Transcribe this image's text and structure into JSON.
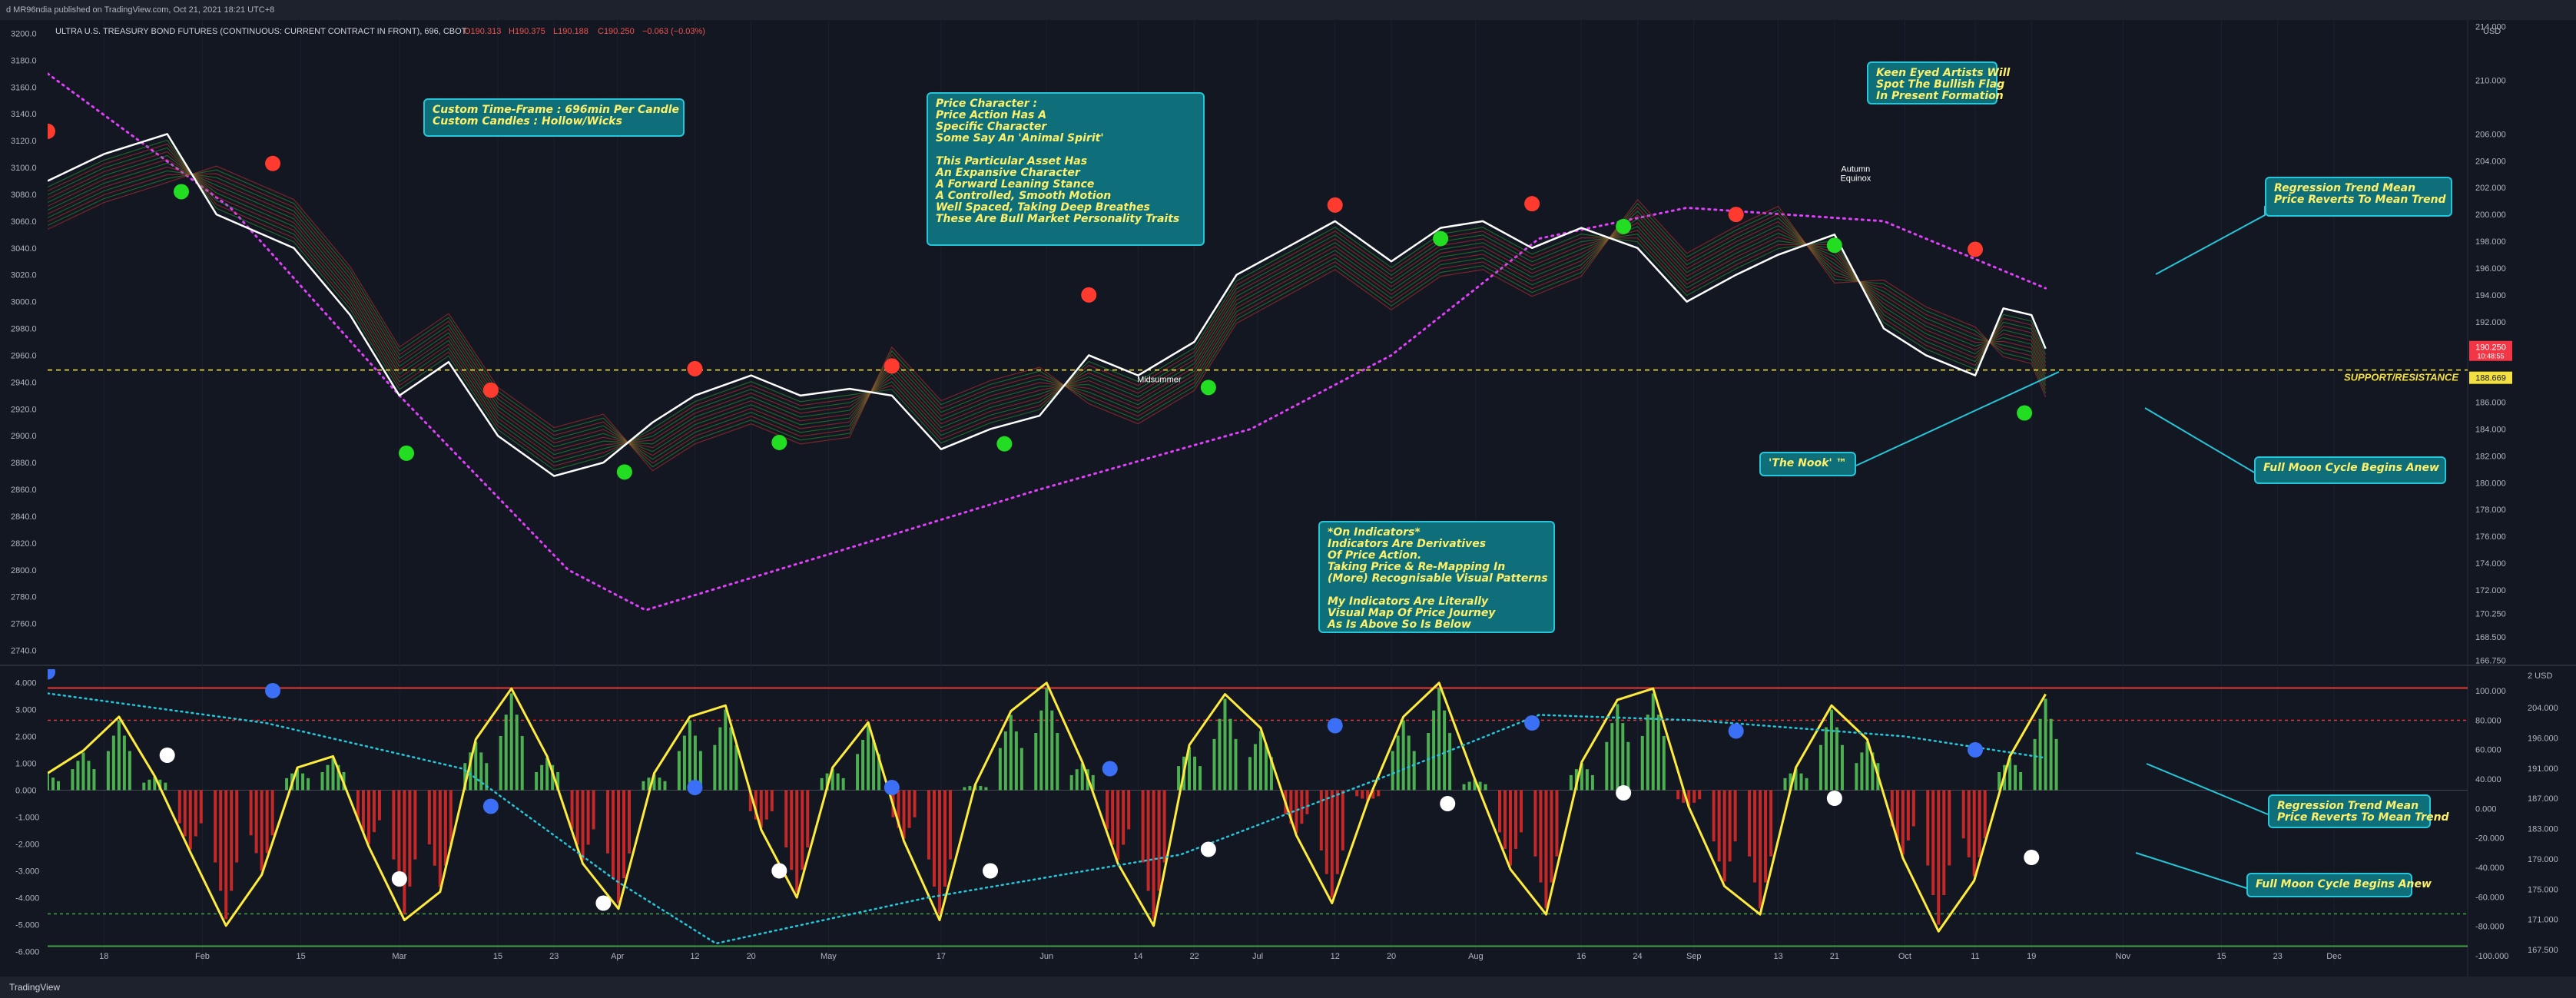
{
  "header": {
    "publisher": "d MR96ndia published on TradingView.com, Oct 21, 2021 18:21 UTC+8",
    "symbol_line": "ULTRA U.S. TREASURY BOND FUTURES (CONTINUOUS: CURRENT CONTRACT IN FRONT), 696, CBOT",
    "ohlc": {
      "o": "O190.313",
      "h": "H190.375",
      "l": "L190.188",
      "c": "C190.250",
      "chg": "−0.063 (−0.03%)"
    }
  },
  "footer": {
    "brand": "TradingView"
  },
  "colors": {
    "background": "#131722",
    "price_line": "#ffffff",
    "bear_ribbon": "#d32f2f",
    "bull_ribbon": "#2e9e2e",
    "support_line": "#f5e042",
    "oscillator_line": "#ffeb3b",
    "up_hist": "#4caf50",
    "down_hist": "#c62828",
    "note_bg": "#0e6e7a",
    "note_border": "#26c6da",
    "note_text": "#fff06a",
    "mean_curve": "#e040fb",
    "osc_mean_curve": "#26c6da",
    "red_dot": "#ff3b30",
    "green_dot": "#22dd22",
    "blue_dot": "#3b6ff5",
    "white_dot": "#ffffff",
    "price_tag": "#f23645",
    "support_tag": "#f5e042"
  },
  "chart_data": [
    {
      "type": "line",
      "panel": "price",
      "series": [
        {
          "x": [
            "Jan 10",
            "Jan 18",
            "Jan 27",
            "Feb 3",
            "Feb 14",
            "Feb 22",
            "Mar 1",
            "Mar 8",
            "Mar 15",
            "Mar 23",
            "Mar 30",
            "Apr 6",
            "Apr 12",
            "Apr 20",
            "Apr 27",
            "May 4",
            "May 10",
            "May 17",
            "May 24",
            "May 31",
            "Jun 7",
            "Jun 14",
            "Jun 22",
            "Jun 28",
            "Jul 5",
            "Jul 12",
            "Jul 20",
            "Jul 27",
            "Aug 2",
            "Aug 9",
            "Aug 16",
            "Aug 24",
            "Aug 31",
            "Sep 7",
            "Sep 13",
            "Sep 21",
            "Sep 28",
            "Oct 4",
            "Oct 11",
            "Oct 15",
            "Oct 19",
            "Oct 21"
          ],
          "values": [
            3090,
            3110,
            3125,
            3065,
            3040,
            2990,
            2930,
            2955,
            2900,
            2870,
            2880,
            2910,
            2930,
            2945,
            2930,
            2935,
            2930,
            2890,
            2905,
            2915,
            2960,
            2945,
            2970,
            3020,
            3040,
            3060,
            3030,
            3055,
            3060,
            3040,
            3055,
            3040,
            3000,
            3020,
            3035,
            3050,
            2980,
            2960,
            2945,
            2995,
            2990,
            2965
          ]
        }
      ],
      "yaxis_left": [
        "3200.0",
        "3180.0",
        "3160.0",
        "3140.0",
        "3120.0",
        "3100.0",
        "3080.0",
        "3060.0",
        "3040.0",
        "3020.0",
        "3000.0",
        "2980.0",
        "2960.0",
        "2940.0",
        "2920.0",
        "2900.0",
        "2880.0",
        "2860.0",
        "2840.0",
        "2820.0",
        "2800.0",
        "2780.0",
        "2760.0",
        "2740.0"
      ],
      "yaxis_right": [
        "214.000",
        "210.000",
        "206.000",
        "204.000",
        "202.000",
        "200.000",
        "198.000",
        "196.000",
        "194.000",
        "192.000",
        "190.000",
        "188.000",
        "186.000",
        "184.000",
        "182.000",
        "180.000",
        "178.000",
        "176.000",
        "174.000",
        "172.000",
        "170.250",
        "168.500",
        "166.750"
      ],
      "ylim_left": [
        2730,
        3210
      ],
      "ylim_right": [
        166.5,
        214.5
      ],
      "right_unit": "USD",
      "support_level": 2949,
      "support_label": "SUPPORT/RESISTANCE",
      "price_tag": "190.250",
      "price_tag_sub": "10:48:55",
      "support_tag": "188.669",
      "bear_dots": [
        [
          "Jan 10",
          3127
        ],
        [
          "Feb 11",
          3103
        ],
        [
          "Mar 14",
          2934
        ],
        [
          "Apr 12",
          2950
        ],
        [
          "May 10",
          2952
        ],
        [
          "Jun 7",
          3005
        ],
        [
          "Jul 12",
          3072
        ],
        [
          "Aug 9",
          3073
        ],
        [
          "Sep 7",
          3065
        ],
        [
          "Oct 11",
          3039
        ]
      ],
      "bull_dots": [
        [
          "Jan 29",
          3082
        ],
        [
          "Mar 2",
          2887
        ],
        [
          "Apr 2",
          2873
        ],
        [
          "Apr 24",
          2895
        ],
        [
          "May 26",
          2894
        ],
        [
          "Jun 24",
          2936
        ],
        [
          "Jul 27",
          3047
        ],
        [
          "Aug 22",
          3056
        ],
        [
          "Sep 21",
          3042
        ],
        [
          "Oct 18",
          2917
        ]
      ],
      "mean_curve": [
        [
          "Jan 10",
          3170
        ],
        [
          "Feb 5",
          3070
        ],
        [
          "Mar 1",
          2930
        ],
        [
          "Mar 25",
          2800
        ],
        [
          "Apr 5",
          2770
        ],
        [
          "Apr 30",
          2810
        ],
        [
          "May 31",
          2860
        ],
        [
          "Jun 30",
          2905
        ],
        [
          "Jul 20",
          2960
        ],
        [
          "Aug 10",
          3047
        ],
        [
          "Aug 31",
          3070
        ],
        [
          "Sep 28",
          3060
        ],
        [
          "Oct 21",
          3010
        ]
      ],
      "annotations": [
        "Autumn",
        "Equinox",
        "Midsummer"
      ]
    },
    {
      "type": "bar",
      "panel": "oscillator",
      "yaxis_left": [
        "4.000",
        "3.000",
        "2.000",
        "1.000",
        "0.000",
        "-1.000",
        "-2.000",
        "-3.000",
        "-4.000",
        "-5.000",
        "-6.000"
      ],
      "yaxis_right": [
        "100.000",
        "80.000",
        "60.000",
        "40.000",
        "0.000",
        "-20.000",
        "-40.000",
        "-60.000",
        "-80.000",
        "-100.000"
      ],
      "yaxis_right_inner": [
        "204.000",
        "196.000",
        "191.000",
        "187.000",
        "183.000",
        "179.000",
        "175.000",
        "171.000",
        "167.500"
      ],
      "right_unit": "2 USD",
      "ylim": [
        -6.5,
        4.5
      ],
      "upper_band": 3.8,
      "upper_dotted": 2.6,
      "lower_dotted": -4.6,
      "lower_band": -5.8,
      "histogram": [
        0.6,
        1.4,
        2.6,
        0.5,
        -2.2,
        -4.8,
        -3.0,
        0.8,
        1.2,
        -2.0,
        -4.6,
        -3.6,
        1.8,
        3.6,
        1.2,
        -2.6,
        -4.2,
        0.6,
        2.6,
        3.0,
        -1.4,
        -3.8,
        0.8,
        2.4,
        -1.8,
        -4.6,
        0.2,
        2.8,
        3.8,
        1.0,
        -2.6,
        -4.8,
        1.6,
        3.4,
        2.2,
        -1.6,
        -4.0,
        -0.4,
        2.6,
        3.8,
        0.4,
        -2.8,
        -4.4,
        1.0,
        3.2,
        3.6,
        -0.6,
        -3.4,
        -4.4,
        0.8,
        3.0,
        1.8,
        -2.4,
        -5.0,
        -3.2,
        1.2,
        3.4
      ],
      "blue_dots": [
        [
          "Jan 10",
          4.4
        ],
        [
          "Feb 11",
          3.7
        ],
        [
          "Mar 14",
          -0.6
        ],
        [
          "Apr 12",
          0.1
        ],
        [
          "May 10",
          0.1
        ],
        [
          "Jun 10",
          0.8
        ],
        [
          "Jul 12",
          2.4
        ],
        [
          "Aug 9",
          2.5
        ],
        [
          "Sep 7",
          2.2
        ],
        [
          "Oct 11",
          1.5
        ]
      ],
      "white_dots": [
        [
          "Jan 27",
          1.3
        ],
        [
          "Mar 1",
          -3.3
        ],
        [
          "Mar 30",
          -4.2
        ],
        [
          "Apr 24",
          -3.0
        ],
        [
          "May 24",
          -3.0
        ],
        [
          "Jun 24",
          -2.2
        ],
        [
          "Jul 28",
          -0.5
        ],
        [
          "Aug 22",
          -0.1
        ],
        [
          "Sep 21",
          -0.3
        ],
        [
          "Oct 19",
          -2.5
        ]
      ]
    }
  ],
  "x_ticks": [
    "18",
    "Feb",
    "15",
    "Mar",
    "15",
    "23",
    "Apr",
    "12",
    "20",
    "May",
    "17",
    "Jun",
    "14",
    "22",
    "Jul",
    "12",
    "20",
    "Aug",
    "16",
    "24",
    "Sep",
    "13",
    "21",
    "Oct",
    "11",
    "19",
    "Nov",
    "15",
    "23",
    "Dec"
  ],
  "notes": [
    {
      "id": "timeframe",
      "text": "Custom Time-Frame : 696min Per Candle\nCustom Candles : Hollow/Wicks"
    },
    {
      "id": "character",
      "text": "Price Character :\nPrice Action Has A\nSpecific Character\nSome Say An 'Animal Spirit'\n\nThis Particular Asset Has\nAn Expansive Character\nA Forward Leaning Stance\nA Controlled, Smooth Motion\nWell Spaced, Taking Deep Breathes\nThese Are Bull Market Personality Traits"
    },
    {
      "id": "flag",
      "text": "Keen Eyed Artists Will\nSpot The Bullish Flag\nIn Present Formation"
    },
    {
      "id": "regression-price",
      "text": "Regression Trend Mean\nPrice Reverts To Mean Trend"
    },
    {
      "id": "nook",
      "text": "'The Nook' ™"
    },
    {
      "id": "fullmoon-price",
      "text": "Full Moon Cycle Begins Anew"
    },
    {
      "id": "indicators",
      "text": "*On Indicators*\nIndicators Are Derivatives\nOf Price Action.\nTaking Price & Re-Mapping In\n(More) Recognisable Visual Patterns\n\nMy Indicators Are Literally\nVisual Map Of Price Journey\nAs Is Above So Is Below"
    },
    {
      "id": "regression-osc",
      "text": "Regression Trend Mean\nPrice Reverts To Mean Trend"
    },
    {
      "id": "fullmoon-osc",
      "text": "Full Moon Cycle Begins Anew"
    }
  ]
}
